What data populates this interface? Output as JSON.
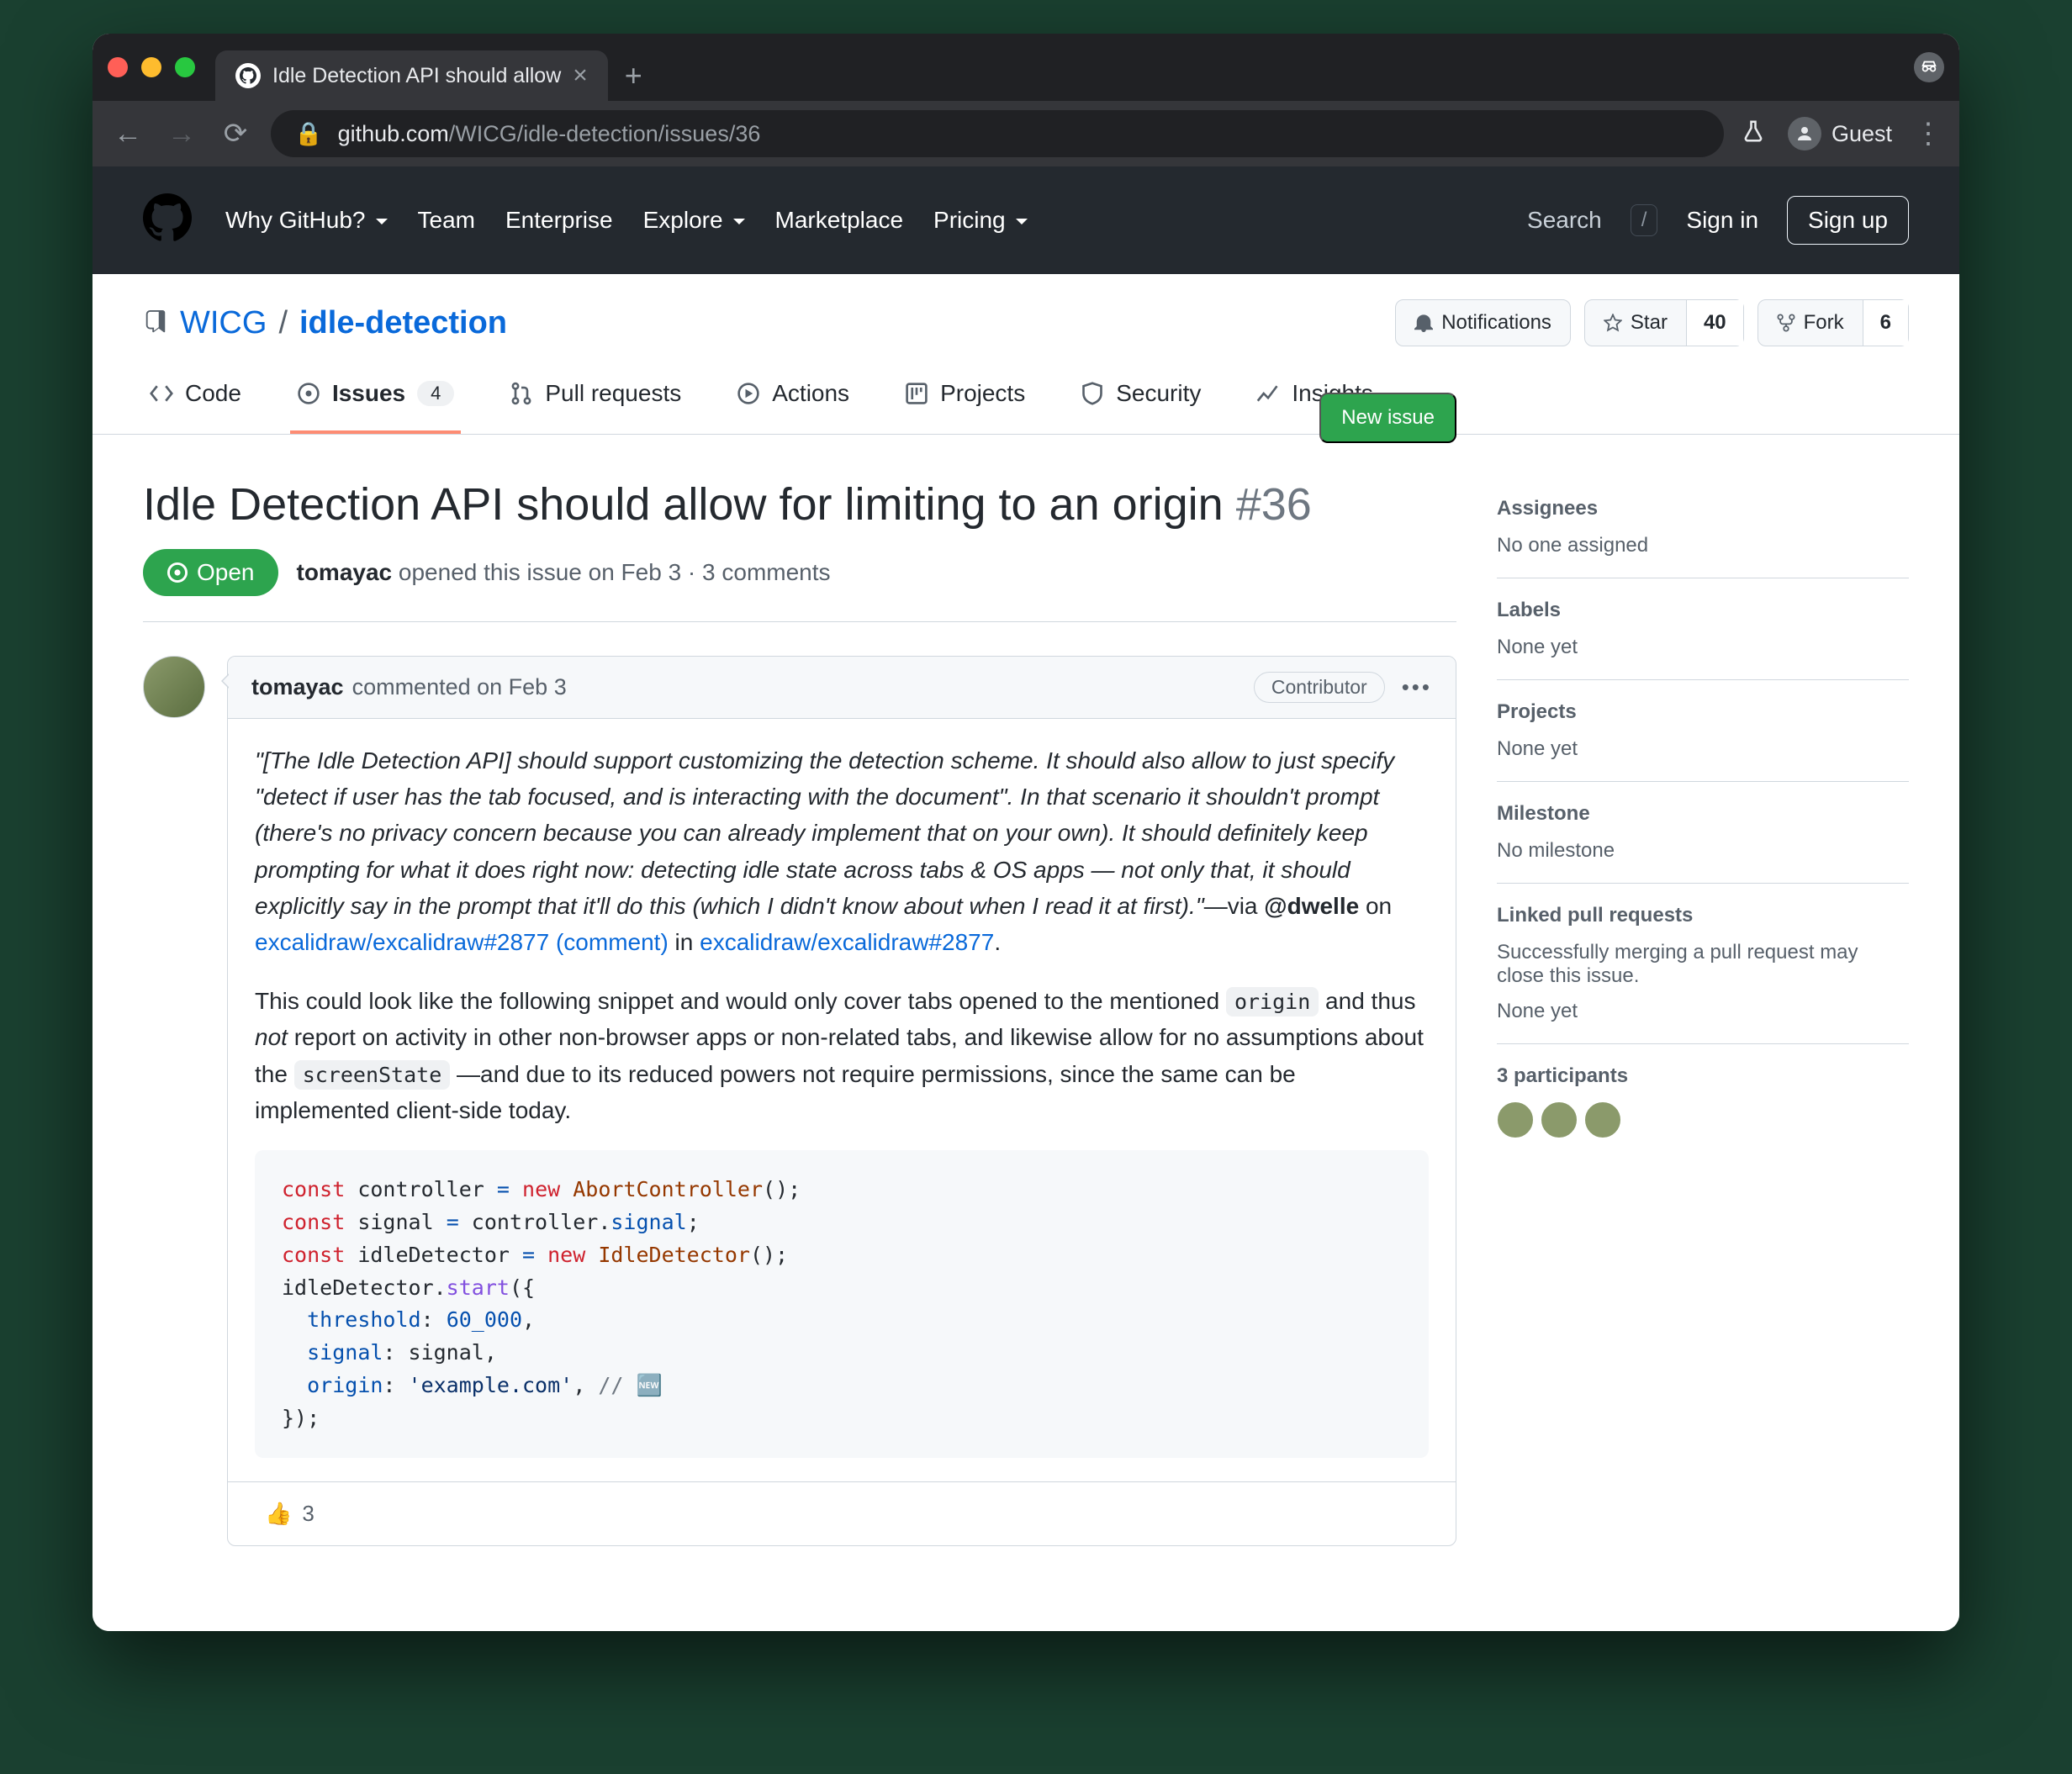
{
  "browser": {
    "tab_title": "Idle Detection API should allow",
    "url_display": "github.com/WICG/idle-detection/issues/36",
    "url_domain": "github.com",
    "url_path": "/WICG/idle-detection/issues/36",
    "guest_label": "Guest"
  },
  "nav": {
    "why": "Why GitHub?",
    "team": "Team",
    "enterprise": "Enterprise",
    "explore": "Explore",
    "marketplace": "Marketplace",
    "pricing": "Pricing",
    "search_placeholder": "Search",
    "slash": "/",
    "signin": "Sign in",
    "signup": "Sign up"
  },
  "repo": {
    "owner": "WICG",
    "name": "idle-detection",
    "notifications": "Notifications",
    "star": "Star",
    "star_count": "40",
    "fork": "Fork",
    "fork_count": "6"
  },
  "tabs": {
    "code": "Code",
    "issues": "Issues",
    "issues_count": "4",
    "pr": "Pull requests",
    "actions": "Actions",
    "projects": "Projects",
    "security": "Security",
    "insights": "Insights"
  },
  "issue": {
    "title": "Idle Detection API should allow for limiting to an origin",
    "number": "#36",
    "status": "Open",
    "author": "tomayac",
    "opened_text": "opened this issue on Feb 3 · 3 comments",
    "new_issue": "New issue"
  },
  "comment": {
    "author": "tomayac",
    "when": "commented on Feb 3",
    "badge": "Contributor",
    "quote": "\"[The Idle Detection API] should support customizing the detection scheme. It should also allow to just specify \"detect if user has the tab focused, and is interacting with the document\". In that scenario it shouldn't prompt (there's no privacy concern because you can already implement that on your own). It should definitely keep prompting for what it does right now: detecting idle state across tabs & OS apps — not only that, it should explicitly say in the prompt that it'll do this (which I didn't know about when I read it at first).\"",
    "via": "—via ",
    "at_user": "@dwelle",
    "via_on": " on ",
    "link1": "excalidraw/excalidraw#2877 (comment)",
    "via_in": " in ",
    "link2": "excalidraw/excalidraw#2877",
    "para2a": "This could look like the following snippet and would only cover tabs opened to the mentioned ",
    "code_origin": "origin",
    "para2b": " and thus ",
    "not": "not",
    "para2c": " report on activity in other non-browser apps or non-related tabs, and likewise allow for no assumptions about the ",
    "code_screen": "screenState",
    "para2d": " —and due to its reduced powers not require permissions, since the same can be implemented client-side today.",
    "react_count": "3"
  },
  "sidebar": {
    "assignees": "Assignees",
    "assignees_val": "No one assigned",
    "labels": "Labels",
    "labels_val": "None yet",
    "projects": "Projects",
    "projects_val": "None yet",
    "milestone": "Milestone",
    "milestone_val": "No milestone",
    "linked": "Linked pull requests",
    "linked_desc": "Successfully merging a pull request may close this issue.",
    "linked_val": "None yet",
    "participants": "3 participants"
  }
}
